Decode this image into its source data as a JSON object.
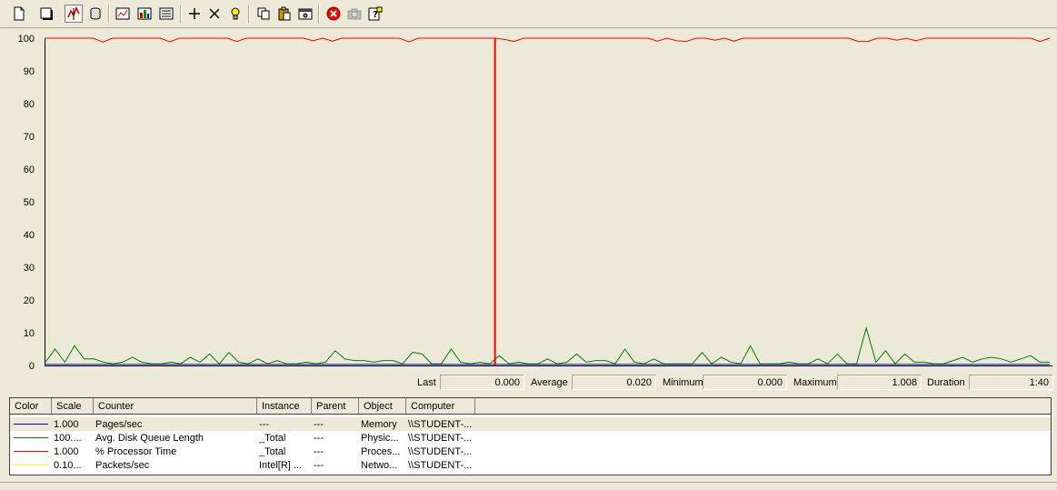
{
  "toolbar": {
    "buttons": [
      {
        "name": "new-counter-set",
        "icon": "new-document-icon"
      },
      {
        "name": "clear-display",
        "icon": "clear-display-icon"
      },
      {
        "name": "view-current-activity",
        "icon": "graph-view-icon",
        "pressed": true
      },
      {
        "name": "view-log-data",
        "icon": "database-icon"
      },
      {
        "name": "view-graph",
        "icon": "chart-icon"
      },
      {
        "name": "view-histogram",
        "icon": "histogram-icon"
      },
      {
        "name": "view-report",
        "icon": "report-icon"
      },
      {
        "name": "add",
        "icon": "plus-icon"
      },
      {
        "name": "delete",
        "icon": "x-icon"
      },
      {
        "name": "highlight",
        "icon": "lightbulb-icon"
      },
      {
        "name": "copy-properties",
        "icon": "copy-icon"
      },
      {
        "name": "paste-counter-list",
        "icon": "paste-icon"
      },
      {
        "name": "properties",
        "icon": "properties-icon"
      },
      {
        "name": "freeze-display",
        "icon": "stop-icon"
      },
      {
        "name": "update-data",
        "icon": "camera-icon"
      },
      {
        "name": "help",
        "icon": "help-icon"
      }
    ]
  },
  "chart_data": {
    "type": "line",
    "ylim": [
      0,
      100
    ],
    "y_ticks": [
      "100",
      "90",
      "80",
      "70",
      "60",
      "50",
      "40",
      "30",
      "20",
      "10",
      "0"
    ],
    "grid": false,
    "background": "#ece9d8",
    "current_time_index": 47,
    "series": [
      {
        "color": "#ff0000",
        "values": [
          100,
          100,
          100,
          100,
          100,
          100,
          98.8,
          100,
          100,
          100,
          100,
          100,
          100,
          98.9,
          100,
          100,
          100,
          100,
          100,
          100,
          99.0,
          100,
          100,
          100,
          100,
          100,
          100,
          100,
          99.2,
          100,
          99.1,
          100,
          100,
          100,
          100,
          100,
          100,
          100,
          98.9,
          100,
          100,
          100,
          100,
          100,
          100,
          100,
          100,
          100,
          99.6,
          99.0,
          100,
          100,
          100,
          100,
          100,
          100,
          100,
          100,
          100,
          100,
          100,
          100,
          100,
          100,
          99.1,
          100,
          99.2,
          99.0,
          100,
          100,
          99.4,
          100,
          99.1,
          100,
          100,
          100,
          100,
          100,
          100,
          100,
          100,
          100,
          100,
          100,
          100,
          99.0,
          99.0,
          100,
          100,
          99.4,
          100,
          99.2,
          100,
          100,
          100,
          100,
          100,
          100,
          100,
          100,
          100,
          100,
          100,
          100,
          99.0,
          100
        ]
      },
      {
        "color": "#008000",
        "values": [
          1,
          5,
          1,
          6,
          2,
          2,
          1,
          0.5,
          1,
          2.5,
          1,
          0.5,
          0.5,
          1,
          0.5,
          2.5,
          1,
          3.5,
          0.5,
          4,
          1,
          0.5,
          2,
          0.5,
          1.5,
          0.5,
          0.5,
          1,
          0.5,
          1,
          4.5,
          2,
          1.5,
          1.5,
          1,
          1.5,
          1.5,
          0.5,
          4,
          3.5,
          0.5,
          0.5,
          5,
          1,
          0.5,
          1,
          0.5,
          3,
          0.5,
          1,
          0.5,
          0.5,
          2,
          0.5,
          1,
          3.5,
          1,
          1.5,
          1.5,
          0.5,
          5,
          1,
          0.5,
          2,
          0.5,
          0.5,
          0.5,
          0.5,
          4,
          0.5,
          2.5,
          1,
          0.5,
          6,
          0.5,
          0.5,
          0.5,
          1,
          0.5,
          0.5,
          2,
          0.5,
          3.5,
          0.5,
          0.5,
          11.5,
          1,
          4.5,
          0.5,
          3.5,
          1,
          1,
          0.5,
          0.5,
          1.5,
          2.5,
          1,
          2,
          2.5,
          2,
          1,
          2,
          3,
          1,
          1
        ]
      },
      {
        "color": "#0000cc",
        "values": [
          0.3,
          0.3,
          0.3,
          0.3,
          0.3,
          0.3,
          0.3,
          0.3,
          0.3,
          0.3,
          0.3,
          0.3,
          0.3,
          0.3,
          0.3,
          0.3,
          0.3,
          0.3,
          0.3,
          0.3,
          0.3,
          0.3,
          0.3,
          0.3,
          0.3,
          0.3,
          0.3,
          0.3,
          0.3,
          0.3,
          0.3,
          0.3,
          0.3,
          0.3,
          0.3,
          0.3,
          0.3,
          0.3,
          0.3,
          0.3,
          0.3,
          0.3,
          0.3,
          0.3,
          0.3,
          0.3,
          0.3,
          0.3,
          0.3,
          0.3,
          0.3,
          0.3,
          0.3,
          0.3,
          0.3,
          0.3,
          0.3,
          0.3,
          0.3,
          0.3,
          0.3,
          0.3,
          0.3,
          0.3,
          0.3,
          0.3,
          0.3,
          0.3,
          0.3,
          0.3,
          0.3,
          0.3,
          0.3,
          0.3,
          0.3,
          0.3,
          0.3,
          0.3,
          0.3,
          0.3,
          0.3,
          0.3,
          0.3,
          0.3,
          0.3,
          0.3,
          0.3,
          0.3,
          0.3,
          0.3,
          0.3,
          0.3,
          0.3,
          0.3,
          0.3,
          0.3,
          0.3,
          0.3,
          0.3,
          0.3,
          0.3,
          0.3,
          0.3,
          0.3,
          0.3
        ]
      }
    ]
  },
  "stats": {
    "last_label": "Last",
    "last_value": "0.000",
    "average_label": "Average",
    "average_value": "0.020",
    "minimum_label": "Minimum",
    "minimum_value": "0.000",
    "maximum_label": "Maximum",
    "maximum_value": "1.008",
    "duration_label": "Duration",
    "duration_value": "1:40"
  },
  "legend": {
    "headers": {
      "color": "Color",
      "scale": "Scale",
      "counter": "Counter",
      "instance": "Instance",
      "parent": "Parent",
      "object": "Object",
      "computer": "Computer"
    },
    "rows": [
      {
        "color": "#0000cc",
        "scale": "1.000",
        "counter": "Pages/sec",
        "instance": "---",
        "parent": "---",
        "object": "Memory",
        "computer": "\\\\STUDENT-...",
        "selected": true
      },
      {
        "color": "#008000",
        "scale": "100....",
        "counter": "Avg. Disk Queue Length",
        "instance": "_Total",
        "parent": "---",
        "object": "Physic...",
        "computer": "\\\\STUDENT-..."
      },
      {
        "color": "#ff0000",
        "scale": "1.000",
        "counter": "% Processor Time",
        "instance": "_Total",
        "parent": "---",
        "object": "Proces...",
        "computer": "\\\\STUDENT-..."
      },
      {
        "color": "#ffff00",
        "scale": "0.10...",
        "counter": "Packets/sec",
        "instance": "Intel[R] ...",
        "parent": "---",
        "object": "Netwo...",
        "computer": "\\\\STUDENT-..."
      }
    ]
  }
}
